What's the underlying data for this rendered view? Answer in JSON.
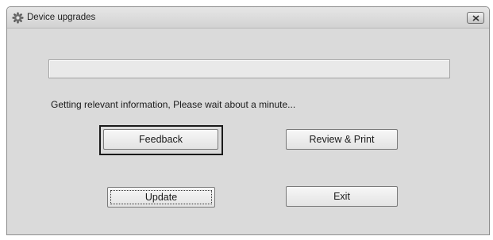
{
  "window": {
    "title": "Device upgrades",
    "icon": "gear-icon",
    "close_icon": "close-icon"
  },
  "progress": {
    "value": 0
  },
  "status_text": "Getting relevant information, Please wait about a minute...",
  "buttons": {
    "feedback": "Feedback",
    "review_print": "Review & Print",
    "update": "Update",
    "exit": "Exit"
  }
}
